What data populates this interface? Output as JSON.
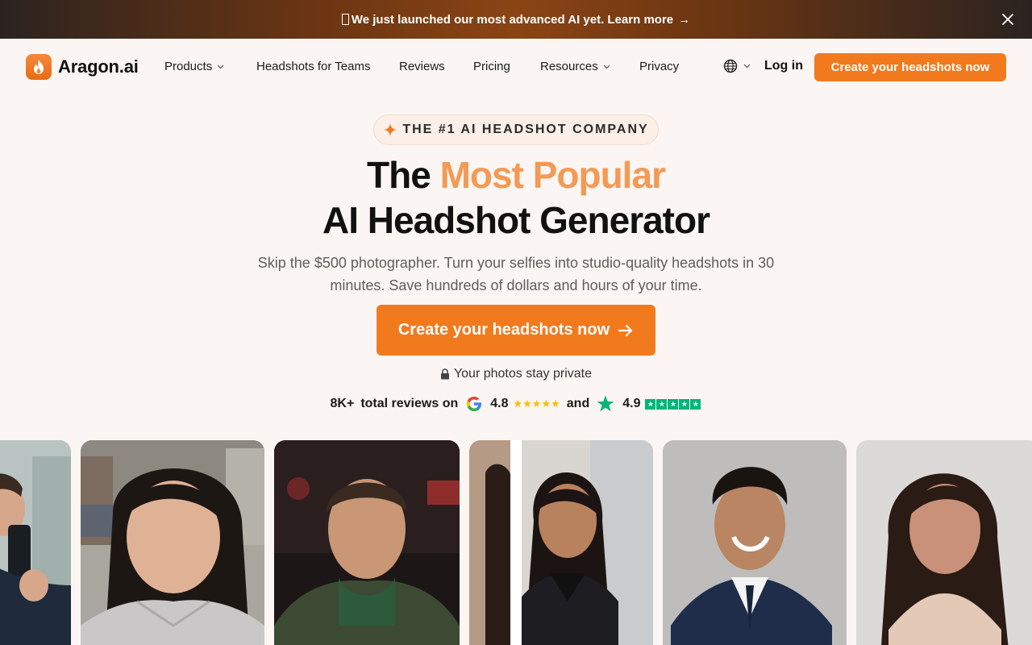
{
  "announcement": {
    "text": "We just launched our most advanced AI yet. Learn more",
    "arrow": "→"
  },
  "nav": {
    "logo": "Aragon.ai",
    "items": [
      {
        "label": "Products",
        "has_dropdown": true
      },
      {
        "label": "Headshots for Teams",
        "has_dropdown": false
      },
      {
        "label": "Reviews",
        "has_dropdown": false
      },
      {
        "label": "Pricing",
        "has_dropdown": false
      },
      {
        "label": "Resources",
        "has_dropdown": true
      },
      {
        "label": "Privacy",
        "has_dropdown": false
      }
    ],
    "login": "Log in",
    "cta": "Create your headshots now"
  },
  "hero": {
    "badge": "THE #1 AI HEADSHOT COMPANY",
    "title_part1": "The ",
    "title_accent": "Most Popular",
    "title_line2": "AI Headshot Generator",
    "subtitle": "Skip the $500 photographer. Turn your selfies into studio-quality headshots in 30 minutes. Save hundreds of dollars and hours of your time.",
    "cta": "Create your headshots now",
    "privacy": "Your photos stay private",
    "reviews_count": "8K+",
    "reviews_text": "total reviews on",
    "google_rating": "4.8",
    "and": "and",
    "trustpilot_rating": "4.9"
  },
  "colors": {
    "brand": "#f27a1e",
    "accent_text": "#f39a55",
    "trustpilot": "#00b67a",
    "google_star": "#fbbc05"
  },
  "icons": [
    "flame-logo-icon",
    "close-icon",
    "globe-icon",
    "chevron-down-icon",
    "sparkle-icon",
    "lock-icon",
    "google-icon",
    "trustpilot-star-icon",
    "arrow-right-icon"
  ]
}
